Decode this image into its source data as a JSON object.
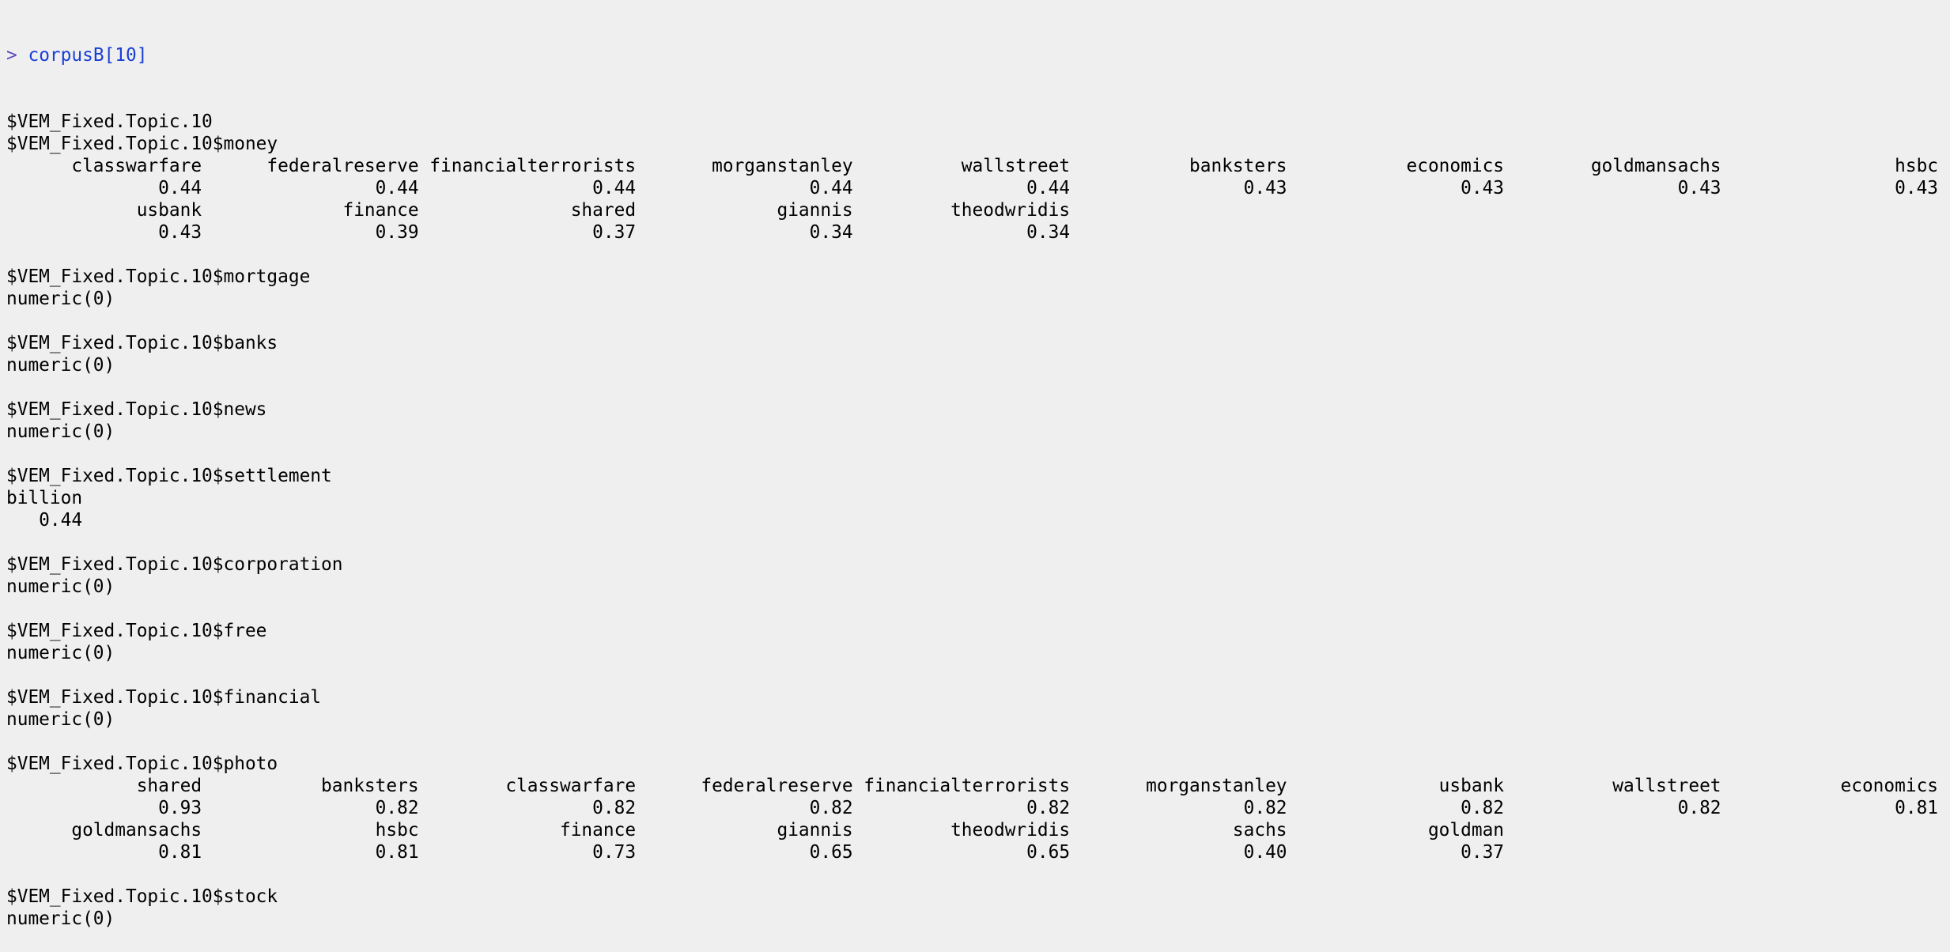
{
  "colors": {
    "background": "#efefef",
    "text": "#000000",
    "prompt": "#5a4fb8",
    "command": "#1a3fd6"
  },
  "console": {
    "prompt": {
      "symbol": ">",
      "command": "corpusB[10]"
    },
    "output_lines": [
      "$VEM_Fixed.Topic.10",
      "$VEM_Fixed.Topic.10$money",
      "      classwarfare      federalreserve financialterrorists       morganstanley          wallstreet           banksters           economics        goldmansachs                hsbc",
      "              0.44                0.44                0.44                0.44                0.44                0.43                0.43                0.43                0.43",
      "            usbank             finance              shared             giannis         theodwridis",
      "              0.43                0.39                0.37                0.34                0.34",
      "",
      "$VEM_Fixed.Topic.10$mortgage",
      "numeric(0)",
      "",
      "$VEM_Fixed.Topic.10$banks",
      "numeric(0)",
      "",
      "$VEM_Fixed.Topic.10$news",
      "numeric(0)",
      "",
      "$VEM_Fixed.Topic.10$settlement",
      "billion",
      "   0.44",
      "",
      "$VEM_Fixed.Topic.10$corporation",
      "numeric(0)",
      "",
      "$VEM_Fixed.Topic.10$free",
      "numeric(0)",
      "",
      "$VEM_Fixed.Topic.10$financial",
      "numeric(0)",
      "",
      "$VEM_Fixed.Topic.10$photo",
      "            shared           banksters        classwarfare      federalreserve financialterrorists       morganstanley              usbank          wallstreet           economics",
      "              0.93                0.82                0.82                0.82                0.82                0.82                0.82                0.82                0.81",
      "      goldmansachs                hsbc             finance             giannis         theodwridis               sachs             goldman",
      "              0.81                0.81                0.73                0.65                0.65                0.40                0.37",
      "",
      "$VEM_Fixed.Topic.10$stock",
      "numeric(0)"
    ]
  }
}
